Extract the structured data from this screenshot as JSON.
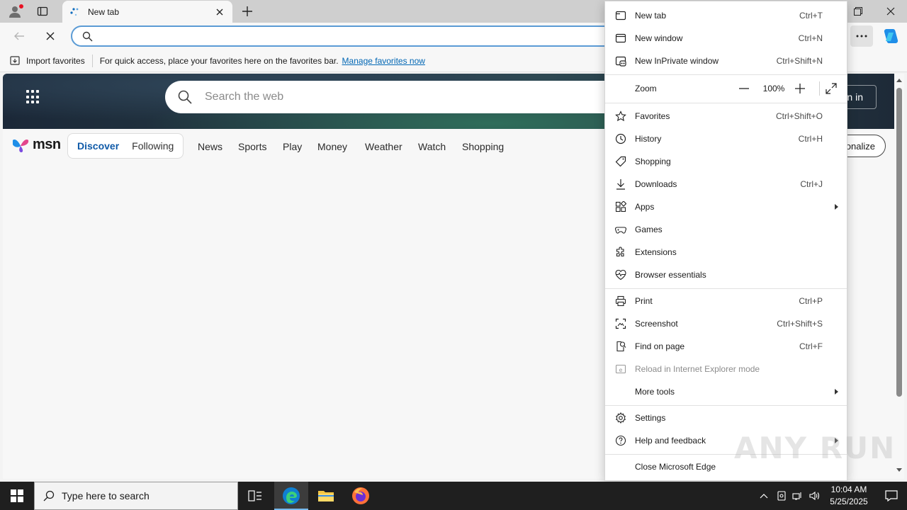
{
  "tab": {
    "title": "New tab"
  },
  "favorites_bar": {
    "import_label": "Import favorites",
    "hint": "For quick access, place your favorites here on the favorites bar.",
    "manage_link": "Manage favorites now"
  },
  "page": {
    "search_placeholder": "Search the web",
    "signin_partial": "n in",
    "personalize_partial": "sonalize",
    "msn_logo": "msn",
    "feed_tabs": [
      "Discover",
      "Following"
    ],
    "categories": [
      "News",
      "Sports",
      "Play",
      "Money",
      "Weather",
      "Watch",
      "Shopping"
    ]
  },
  "menu": {
    "items": [
      {
        "label": "New tab",
        "shortcut": "Ctrl+T",
        "icon": "new-tab-icon"
      },
      {
        "label": "New window",
        "shortcut": "Ctrl+N",
        "icon": "new-window-icon"
      },
      {
        "label": "New InPrivate window",
        "shortcut": "Ctrl+Shift+N",
        "icon": "inprivate-icon"
      },
      {
        "label": "Zoom",
        "value": "100%"
      },
      {
        "label": "Favorites",
        "shortcut": "Ctrl+Shift+O",
        "icon": "star-icon"
      },
      {
        "label": "History",
        "shortcut": "Ctrl+H",
        "icon": "history-icon"
      },
      {
        "label": "Shopping",
        "shortcut": "",
        "icon": "tag-icon"
      },
      {
        "label": "Downloads",
        "shortcut": "Ctrl+J",
        "icon": "download-icon"
      },
      {
        "label": "Apps",
        "shortcut": "",
        "icon": "apps-icon",
        "submenu": true
      },
      {
        "label": "Games",
        "shortcut": "",
        "icon": "games-icon"
      },
      {
        "label": "Extensions",
        "shortcut": "",
        "icon": "puzzle-icon"
      },
      {
        "label": "Browser essentials",
        "shortcut": "",
        "icon": "heart-pulse-icon"
      },
      {
        "label": "Print",
        "shortcut": "Ctrl+P",
        "icon": "printer-icon"
      },
      {
        "label": "Screenshot",
        "shortcut": "Ctrl+Shift+S",
        "icon": "screenshot-icon"
      },
      {
        "label": "Find on page",
        "shortcut": "Ctrl+F",
        "icon": "find-icon"
      },
      {
        "label": "Reload in Internet Explorer mode",
        "shortcut": "",
        "icon": "ie-icon",
        "disabled": true
      },
      {
        "label": "More tools",
        "shortcut": "",
        "submenu": true
      },
      {
        "label": "Settings",
        "shortcut": "",
        "icon": "gear-icon"
      },
      {
        "label": "Help and feedback",
        "shortcut": "",
        "icon": "help-icon",
        "submenu": true
      },
      {
        "label": "Close Microsoft Edge",
        "shortcut": ""
      }
    ]
  },
  "watermark": "ANY RUN",
  "taskbar": {
    "search_placeholder": "Type here to search",
    "time": "10:04 AM",
    "date": "5/25/2025"
  },
  "colors": {
    "accent": "#0f5aa8",
    "address_border": "#5b9bd5",
    "taskbar": "#1f1f1f",
    "profile_badge": "#e81123"
  }
}
